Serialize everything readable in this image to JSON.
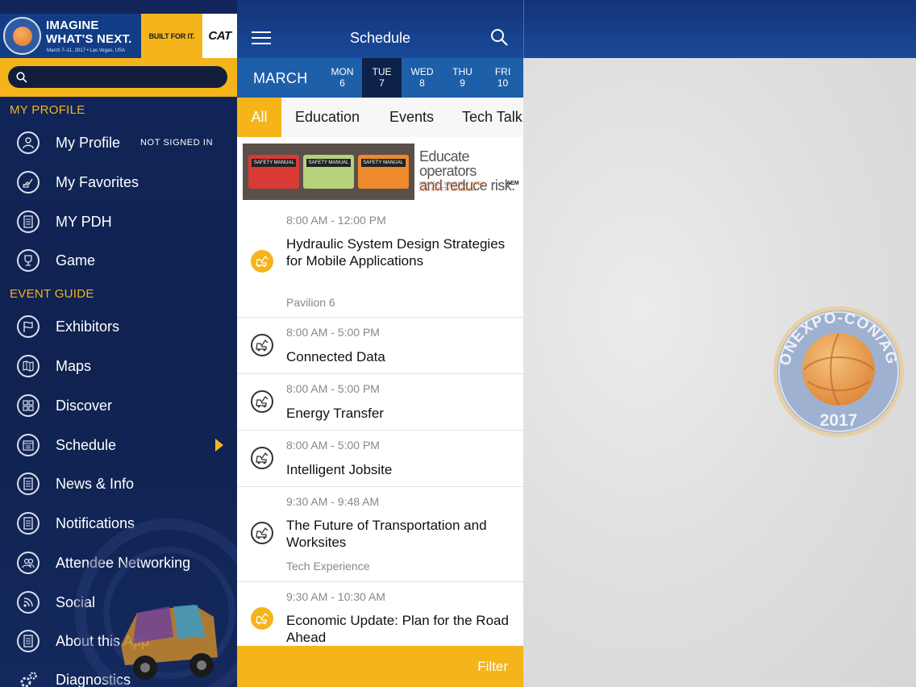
{
  "banner": {
    "line1": "IMAGINE",
    "line2": "WHAT'S NEXT.",
    "sub": "March 7–11, 2017 • Las Vegas, USA",
    "logo_year": "2017",
    "built": "BUILT FOR IT.",
    "cat": "CAT"
  },
  "sidebar": {
    "search_placeholder": "",
    "section_profile": "MY PROFILE",
    "section_event": "EVENT GUIDE",
    "items": [
      {
        "label": "My Profile",
        "badge": "NOT SIGNED IN",
        "icon": "user-icon"
      },
      {
        "label": "My Favorites",
        "icon": "favorites-icon"
      },
      {
        "label": "MY PDH",
        "icon": "pdh-icon"
      },
      {
        "label": "Game",
        "icon": "trophy-icon"
      },
      {
        "label": "Exhibitors",
        "icon": "flag-icon"
      },
      {
        "label": "Maps",
        "icon": "map-icon"
      },
      {
        "label": "Discover",
        "icon": "grid-icon"
      },
      {
        "label": "Schedule",
        "icon": "calendar-icon",
        "selected": true
      },
      {
        "label": "News & Info",
        "icon": "news-icon"
      },
      {
        "label": "Notifications",
        "icon": "notification-icon"
      },
      {
        "label": "Attendee Networking",
        "icon": "people-icon"
      },
      {
        "label": "Social",
        "icon": "rss-icon"
      },
      {
        "label": "About this App",
        "icon": "document-icon"
      },
      {
        "label": "Diagnostics",
        "icon": "gears-icon"
      }
    ]
  },
  "schedule": {
    "title": "Schedule",
    "month": "MARCH",
    "days": [
      {
        "dow": "MON",
        "num": "6"
      },
      {
        "dow": "TUE",
        "num": "7",
        "active": true
      },
      {
        "dow": "WED",
        "num": "8"
      },
      {
        "dow": "THU",
        "num": "9"
      },
      {
        "dow": "FRI",
        "num": "10"
      }
    ],
    "filters": [
      "All",
      "Education",
      "Events",
      "Tech Talk"
    ],
    "ad": {
      "headline_1": "Educate operators",
      "headline_2": "and reduce risk.",
      "tag_1": "PROTECT YOURSELF WITH",
      "tag_2": "AEM SAFETY MANUALS.",
      "brand": "AEM",
      "manual_label": "SAFETY MANUAL",
      "manual_colors": [
        "#d93a35",
        "#b6d27a",
        "#ec8a2c"
      ]
    },
    "sessions": [
      {
        "time": "8:00 AM - 12:00 PM",
        "title": "Hydraulic System Design Strategies for Mobile Applications",
        "location": "Pavilion 6",
        "icon_style": "orange"
      },
      {
        "time": "8:00 AM - 5:00 PM",
        "title": "Connected Data",
        "location": "",
        "icon_style": "outline"
      },
      {
        "time": "8:00 AM - 5:00 PM",
        "title": "Energy Transfer",
        "location": "",
        "icon_style": "outline"
      },
      {
        "time": "8:00 AM - 5:00 PM",
        "title": "Intelligent Jobsite",
        "location": "",
        "icon_style": "outline"
      },
      {
        "time": "9:30 AM - 9:48 AM",
        "title": "The Future of Transportation and Worksites",
        "location": "Tech Experience",
        "icon_style": "outline"
      },
      {
        "time": "9:30 AM - 10:30 AM",
        "title": "Economic Update: Plan for the Road Ahead",
        "location": "",
        "icon_style": "orange"
      }
    ],
    "filter_button": "Filter"
  },
  "watermark": {
    "text": "CONEXPO-CON/AGG",
    "year": "2017"
  },
  "colors": {
    "accent": "#f4b41a",
    "navy": "#12255a",
    "header_blue": "#1a4a9b",
    "datebar_blue": "#1e5faa"
  }
}
